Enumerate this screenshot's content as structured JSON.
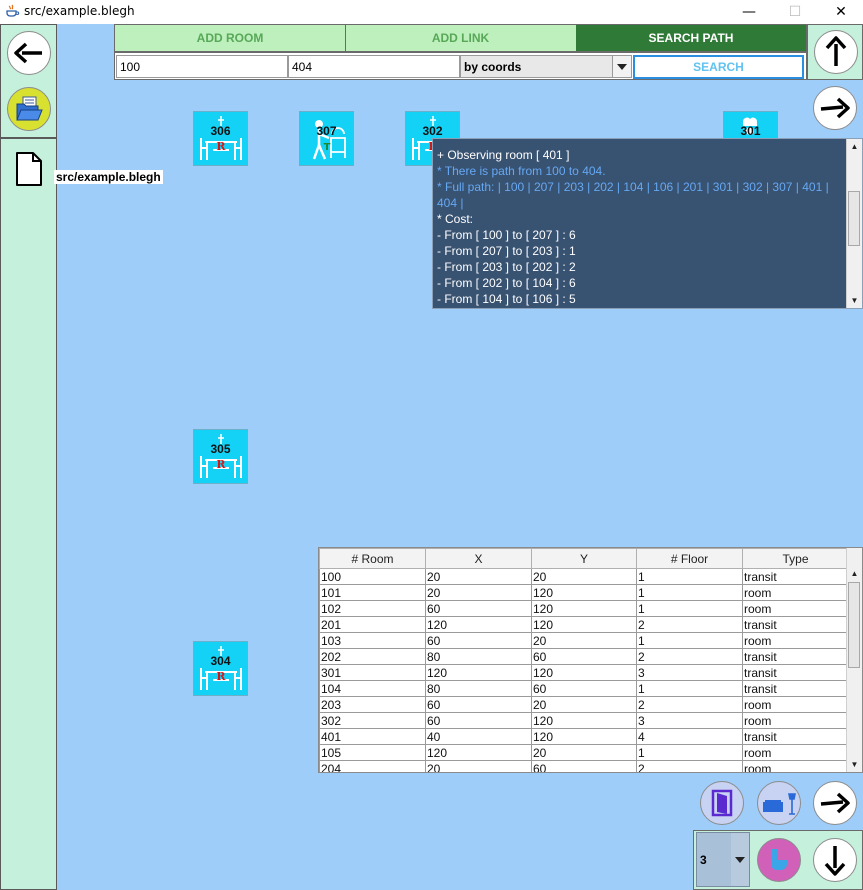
{
  "window": {
    "title": "src/example.blegh",
    "minimize": "—",
    "maximize": "☐",
    "close": "✕"
  },
  "sidebar": {
    "file_label": "src/example.blegh"
  },
  "toolbar": {
    "tabs": [
      {
        "label": "ADD ROOM",
        "active": false
      },
      {
        "label": "ADD LINK",
        "active": false
      },
      {
        "label": "SEARCH PATH",
        "active": true
      }
    ],
    "from_value": "100",
    "to_value": "404",
    "mode_value": "by coords",
    "search_label": "SEARCH"
  },
  "rooms": [
    {
      "id": "306",
      "kind": "restaurant"
    },
    {
      "id": "307",
      "kind": "room-service"
    },
    {
      "id": "302",
      "kind": "restaurant"
    },
    {
      "id": "301",
      "kind": "chef"
    },
    {
      "id": "305",
      "kind": "restaurant"
    },
    {
      "id": "304",
      "kind": "restaurant"
    }
  ],
  "log": {
    "lines": [
      {
        "text": " + Observing room [ 401 ]",
        "color": "white"
      },
      {
        "text": "* There is path from 100 to 404.",
        "color": "blue"
      },
      {
        "text": "* Full path: | 100 | 207 | 203 | 202 | 104 | 106 | 201 | 301 | 302 | 307 | 401 |",
        "color": "blue"
      },
      {
        "text": "404 |",
        "color": "blue"
      },
      {
        "text": "* Cost:",
        "color": "white"
      },
      {
        "text": "- From [ 100 ] to [ 207 ] : 6",
        "color": "white"
      },
      {
        "text": "- From [ 207 ] to [ 203 ] : 1",
        "color": "white"
      },
      {
        "text": "- From [ 203 ] to [ 202 ] : 2",
        "color": "white"
      },
      {
        "text": "- From [ 202 ] to [ 104 ] : 6",
        "color": "white"
      },
      {
        "text": "- From [ 104 ] to [ 106 ] : 5",
        "color": "white"
      }
    ]
  },
  "table": {
    "headers": [
      "# Room",
      "X",
      "Y",
      "# Floor",
      "Type"
    ],
    "rows": [
      [
        "100",
        "20",
        "20",
        "1",
        "transit"
      ],
      [
        "101",
        "20",
        "120",
        "1",
        "room"
      ],
      [
        "102",
        "60",
        "120",
        "1",
        "room"
      ],
      [
        "201",
        "120",
        "120",
        "2",
        "transit"
      ],
      [
        "103",
        "60",
        "20",
        "1",
        "room"
      ],
      [
        "202",
        "80",
        "60",
        "2",
        "transit"
      ],
      [
        "301",
        "120",
        "120",
        "3",
        "transit"
      ],
      [
        "104",
        "80",
        "60",
        "1",
        "transit"
      ],
      [
        "203",
        "60",
        "20",
        "2",
        "room"
      ],
      [
        "302",
        "60",
        "120",
        "3",
        "room"
      ],
      [
        "401",
        "40",
        "120",
        "4",
        "transit"
      ],
      [
        "105",
        "120",
        "20",
        "1",
        "room"
      ],
      [
        "204",
        "20",
        "60",
        "2",
        "room"
      ]
    ]
  },
  "floor": {
    "value": "3"
  },
  "colors": {
    "canvas": "#9ecdfa",
    "sidebar": "#c4f0dc",
    "tab_active": "#2f7a36",
    "tab_inactive": "#bdf0bd",
    "room_tile": "#13d2f5",
    "log_bg": "#385272",
    "log_highlight": "#66a8f2"
  }
}
